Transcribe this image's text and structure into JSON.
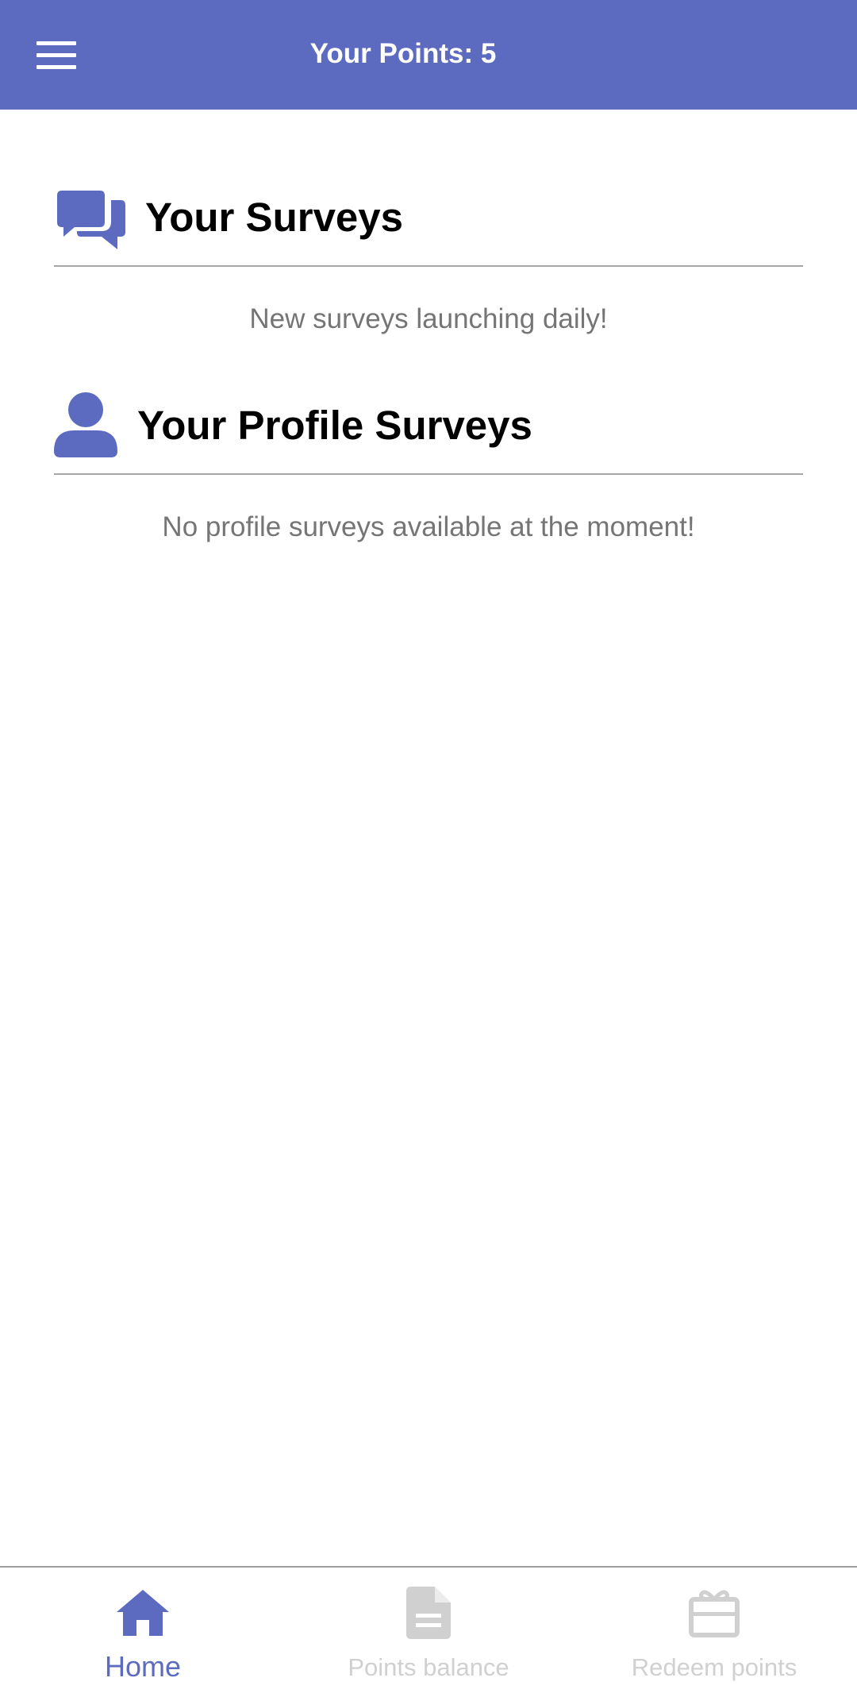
{
  "header": {
    "title": "Your Points: 5",
    "menu_icon": "hamburger-menu-icon"
  },
  "sections": [
    {
      "icon": "chat-bubbles-icon",
      "title": "Your Surveys",
      "empty_message": "New surveys launching daily!"
    },
    {
      "icon": "user-icon",
      "title": "Your Profile Surveys",
      "empty_message": "No profile surveys available at the moment!"
    }
  ],
  "bottom_nav": {
    "items": [
      {
        "label": "Home",
        "icon": "home-icon",
        "active": true
      },
      {
        "label": "Points balance",
        "icon": "document-icon",
        "active": false
      },
      {
        "label": "Redeem points",
        "icon": "gift-icon",
        "active": false
      }
    ]
  },
  "colors": {
    "primary": "#5c6bc0",
    "inactive": "#d0d0d0",
    "divider": "#a6a6a6",
    "muted_text": "#757575"
  }
}
